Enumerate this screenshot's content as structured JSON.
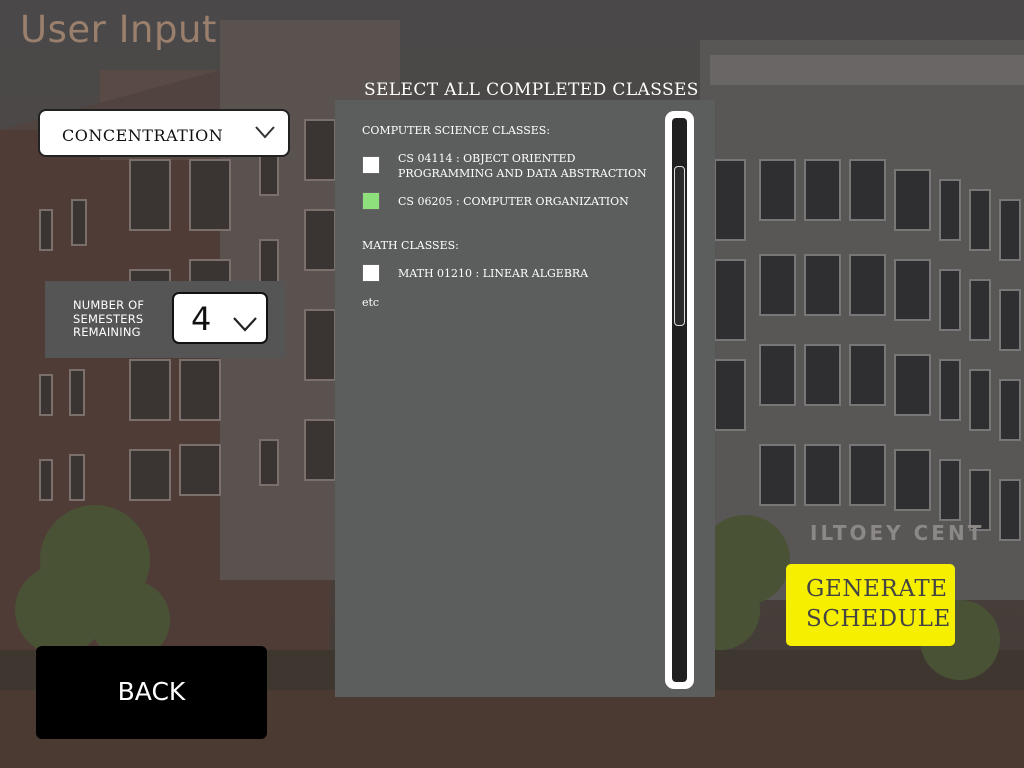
{
  "page": {
    "title": "User Input"
  },
  "concentration": {
    "label": "CONCENTRATION"
  },
  "semesters": {
    "label_line1": "NUMBER OF",
    "label_line2": "SEMESTERS",
    "label_line3": "REMAINING",
    "value": "4"
  },
  "classes": {
    "title": "SELECT ALL COMPLETED CLASSES",
    "groups": [
      {
        "name": "COMPUTER SCIENCE CLASSES:",
        "courses": [
          {
            "label": "CS 04114 : OBJECT ORIENTED PROGRAMMING AND DATA ABSTRACTION",
            "checked": false
          },
          {
            "label": "CS 06205 : COMPUTER ORGANIZATION",
            "checked": true
          }
        ]
      },
      {
        "name": "MATH CLASSES:",
        "courses": [
          {
            "label": "MATH 01210 : LINEAR ALGEBRA",
            "checked": false
          }
        ]
      }
    ],
    "more": "etc"
  },
  "actions": {
    "generate_label": "GENERATE SCHEDULE",
    "back_label": "BACK"
  },
  "colors": {
    "accent_generate": "#f6ef00",
    "checked_fill": "#8ee07c"
  },
  "background": {
    "sign_text": "ILTOEY CENT"
  }
}
